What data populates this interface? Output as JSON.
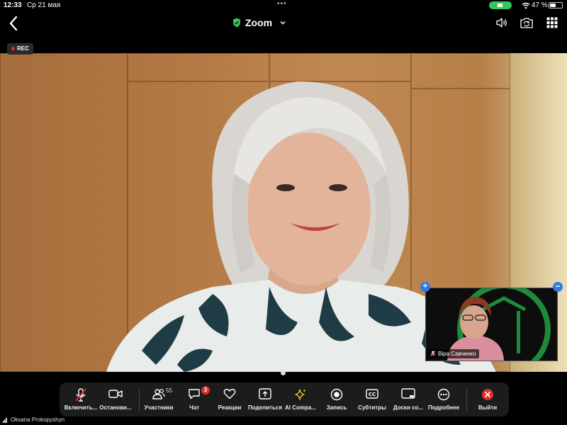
{
  "status": {
    "time": "12:33",
    "date": "Ср 21 мая",
    "battery": "47 %",
    "battery_level": 0.47
  },
  "topbar": {
    "title": "Zoom"
  },
  "rec_label": "REC",
  "thumbnail": {
    "name": "Віра Савченко"
  },
  "toolbar": {
    "mic_label": "Включить...",
    "video_label": "Останови...",
    "participants_label": "Участники",
    "participants_count": "55",
    "chat_label": "Чат",
    "chat_badge": "3",
    "reactions_label": "Реакции",
    "share_label": "Поделиться",
    "ai_label": "AI Compa...",
    "record_label": "Запись",
    "captions_label": "Субтитры",
    "whiteboards_label": "Доски со...",
    "more_label": "Подробнее",
    "leave_label": "Выйти"
  },
  "self_name": "Oksana Prokopyshyn",
  "colors": {
    "accent_green": "#34c759",
    "brand_blue": "#2f7ae5",
    "leave_red": "#e02d2d",
    "toolbar_bg": "#1c1c1c"
  }
}
